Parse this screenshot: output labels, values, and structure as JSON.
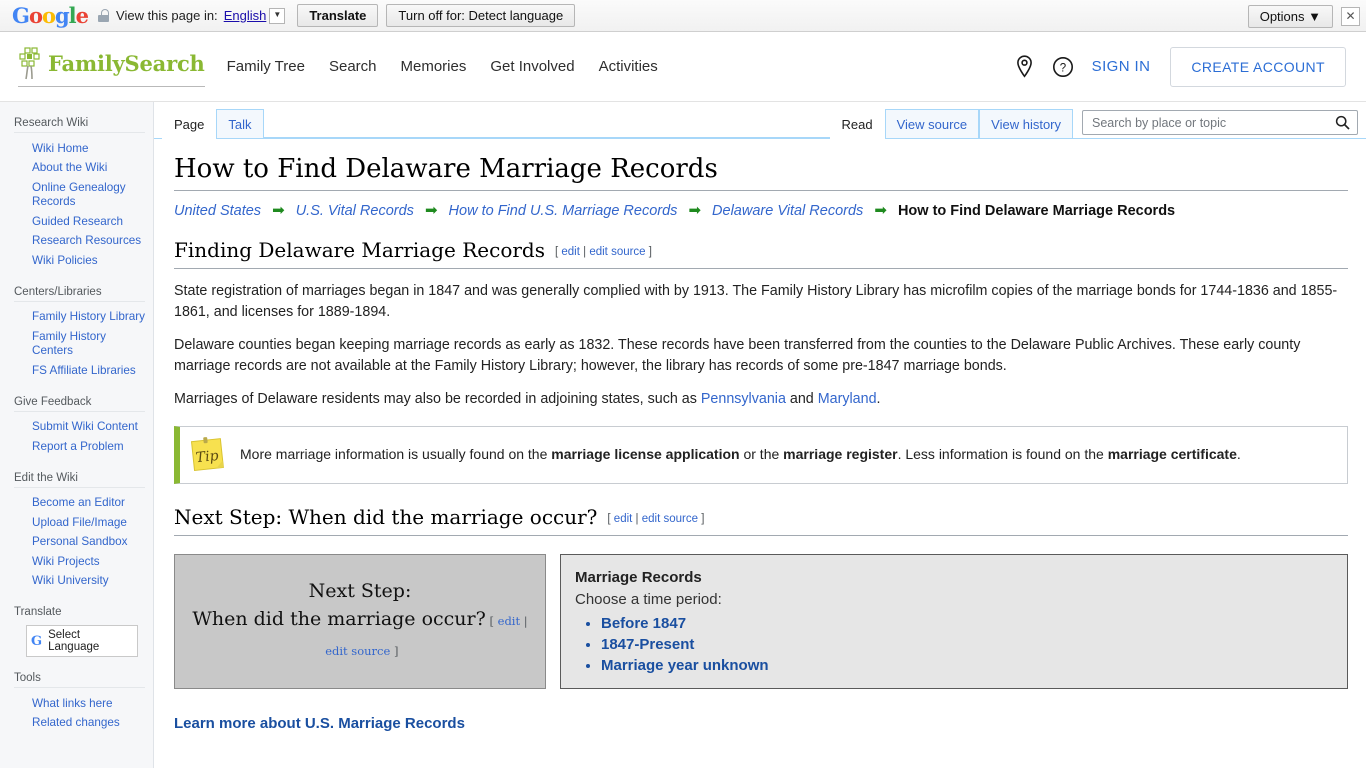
{
  "translate_bar": {
    "logo": "Google",
    "lock_icon": "lock-icon",
    "view_text": "View this page in:",
    "language": "English",
    "translate_label": "Translate",
    "turn_off_label": "Turn off for: Detect language",
    "options_label": "Options ▼",
    "close_icon": "close-icon"
  },
  "header": {
    "brand": "FamilySearch",
    "nav": [
      {
        "label": "Family Tree"
      },
      {
        "label": "Search"
      },
      {
        "label": "Memories"
      },
      {
        "label": "Get Involved"
      },
      {
        "label": "Activities"
      }
    ],
    "location_icon": "location-pin-icon",
    "help_icon": "help-circle-icon",
    "sign_in": "SIGN IN",
    "create_account": "CREATE ACCOUNT"
  },
  "sidebar": {
    "sections": [
      {
        "heading": "Research Wiki",
        "items": [
          "Wiki Home",
          "About the Wiki",
          "Online Genealogy Records",
          "Guided Research",
          "Research Resources",
          "Wiki Policies"
        ]
      },
      {
        "heading": "Centers/Libraries",
        "items": [
          "Family History Library",
          "Family History Centers",
          "FS Affiliate Libraries"
        ]
      },
      {
        "heading": "Give Feedback",
        "items": [
          "Submit Wiki Content",
          "Report a Problem"
        ]
      },
      {
        "heading": "Edit the Wiki",
        "items": [
          "Become an Editor",
          "Upload File/Image",
          "Personal Sandbox",
          "Wiki Projects",
          "Wiki University"
        ]
      }
    ],
    "translate_heading": "Translate",
    "select_language": "Select Language",
    "tools_heading": "Tools",
    "tools_items": [
      "What links here",
      "Related changes"
    ]
  },
  "tabs": {
    "left": [
      {
        "label": "Page",
        "active": true
      },
      {
        "label": "Talk",
        "active": false
      }
    ],
    "right": [
      {
        "label": "Read",
        "active": true
      },
      {
        "label": "View source",
        "active": false
      },
      {
        "label": "View history",
        "active": false
      }
    ]
  },
  "search": {
    "placeholder": "Search by place or topic",
    "value": "",
    "icon": "search-icon"
  },
  "page": {
    "title": "How to Find Delaware Marriage Records",
    "breadcrumbs": [
      {
        "label": "United States",
        "current": false
      },
      {
        "label": "U.S. Vital Records",
        "current": false
      },
      {
        "label": "How to Find U.S. Marriage Records",
        "current": false
      },
      {
        "label": "Delaware Vital Records",
        "current": false
      },
      {
        "label": "How to Find Delaware Marriage Records",
        "current": true
      }
    ],
    "arrow": "➡",
    "section1": {
      "heading": "Finding Delaware Marriage Records",
      "edit": "edit",
      "edit_source": "edit source",
      "paragraph1": "State registration of marriages began in 1847 and was generally complied with by 1913. The Family History Library has microfilm copies of the marriage bonds for 1744-1836 and 1855-1861, and licenses for 1889-1894.",
      "paragraph2": "Delaware counties began keeping marriage records as early as 1832. These records have been transferred from the counties to the Delaware Public Archives. These early county marriage records are not available at the Family History Library; however, the library has records of some pre-1847 marriage bonds.",
      "paragraph3_pre": "Marriages of Delaware residents may also be recorded in adjoining states, such as ",
      "paragraph3_link1": "Pennsylvania",
      "paragraph3_mid": " and ",
      "paragraph3_link2": "Maryland",
      "paragraph3_end": "."
    },
    "tip": {
      "icon": "tip-note-icon",
      "label": "Tip",
      "text_pre": "More marriage information is usually found on the ",
      "bold1": "marriage license application",
      "text_mid": " or the ",
      "bold2": "marriage register",
      "text_mid2": ". Less information is found on the ",
      "bold3": "marriage certificate",
      "text_end": "."
    },
    "section2": {
      "heading": "Next Step: When did the marriage occur?",
      "edit": "edit",
      "edit_source": "edit source"
    },
    "step_box": {
      "line1": "Next Step:",
      "line2": "When did the marriage occur?",
      "edit": "edit",
      "edit_source": "edit source"
    },
    "marriage_records": {
      "title": "Marriage Records",
      "subtitle": "Choose a time period:",
      "links": [
        "Before 1847",
        "1847-Present",
        "Marriage year unknown"
      ]
    },
    "learn_more": "Learn more about U.S. Marriage Records"
  }
}
